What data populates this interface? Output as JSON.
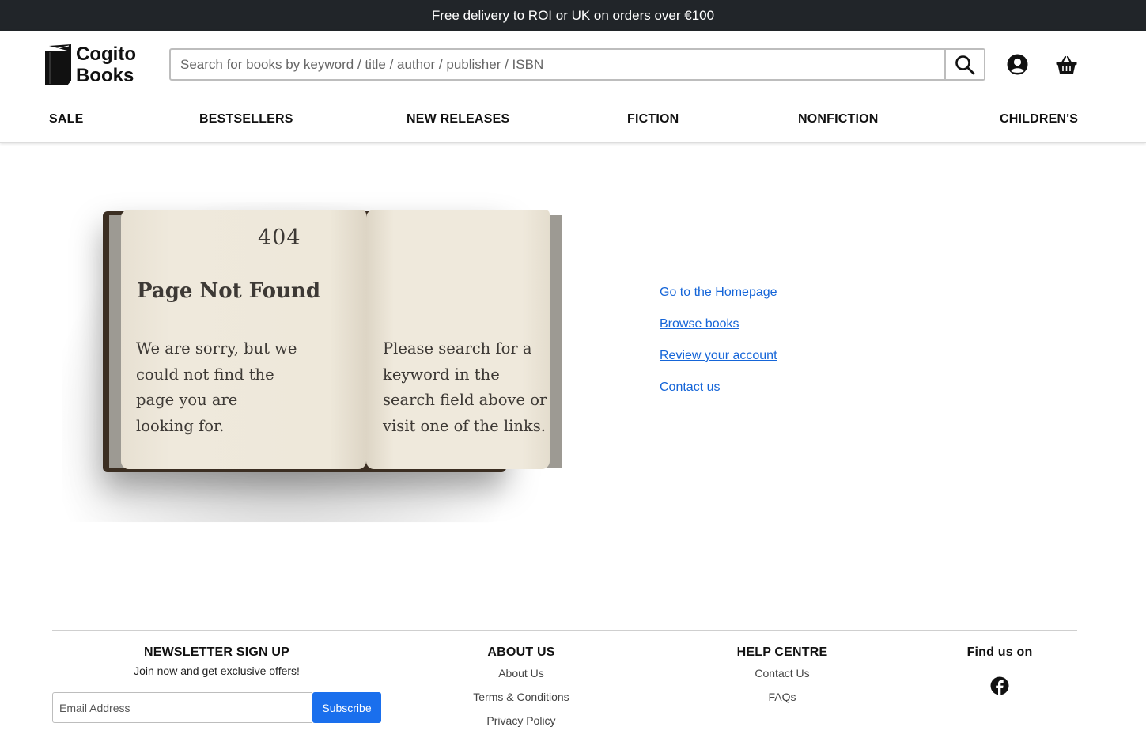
{
  "promo": {
    "text": "Free delivery to ROI or UK on orders over €100"
  },
  "header": {
    "logo": {
      "line1": "Cogito",
      "line2": "Books"
    },
    "search": {
      "placeholder": "Search for books by keyword / title / author / publisher / ISBN",
      "value": ""
    },
    "icons": [
      "search-icon",
      "account-icon",
      "basket-icon"
    ]
  },
  "nav": {
    "items": [
      "SALE",
      "BESTSELLERS",
      "NEW RELEASES",
      "FICTION",
      "NONFICTION",
      "CHILDREN'S"
    ]
  },
  "error_book": {
    "code": "404",
    "title": "Page Not Found",
    "left_text": "We are sorry, but we could not find the page you are looking for.",
    "right_text": "Please search for a keyword in the search field above or visit one of the links."
  },
  "links": [
    "Go to the Homepage",
    "Browse books",
    "Review your account",
    "Contact us"
  ],
  "footer": {
    "newsletter": {
      "heading": "NEWSLETTER SIGN UP",
      "subtext": "Join now and get exclusive offers!",
      "email_placeholder": "Email Address",
      "subscribe_label": "Subscribe"
    },
    "about": {
      "heading": "ABOUT US",
      "links": [
        "About Us",
        "Terms & Conditions",
        "Privacy Policy"
      ]
    },
    "help": {
      "heading": "HELP CENTRE",
      "links": [
        "Contact Us",
        "FAQs"
      ]
    },
    "social": {
      "heading": "Find us on",
      "icon": "facebook-icon"
    }
  },
  "colors": {
    "promo_bg": "#212529",
    "link": "#1565d8",
    "subscribe_bg": "#1a6fed"
  }
}
